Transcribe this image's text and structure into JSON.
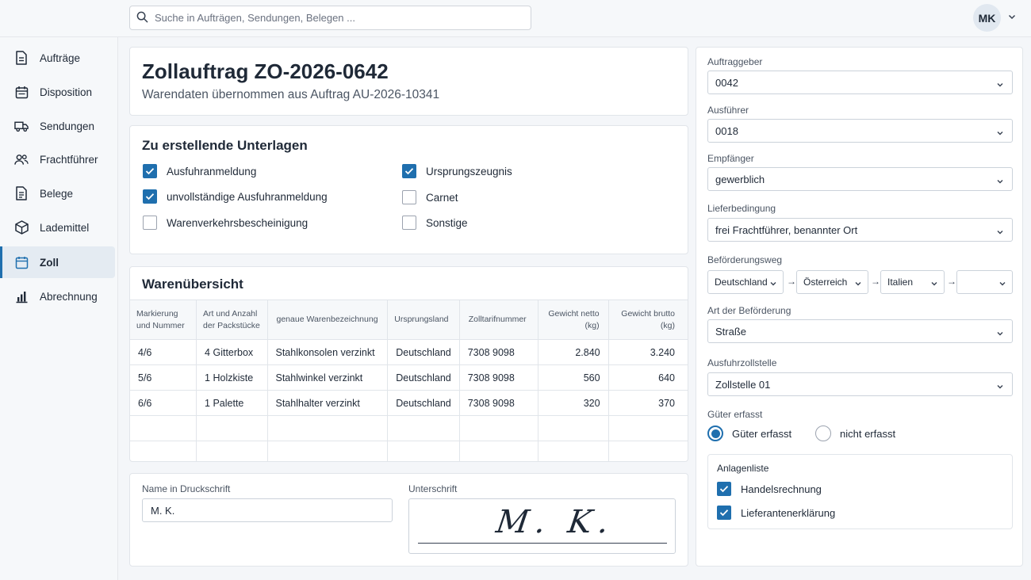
{
  "search": {
    "placeholder": "Suche in Aufträgen, Sendungen, Belegen ..."
  },
  "user": {
    "initials": "MK"
  },
  "sidebar": {
    "items": [
      {
        "label": "Aufträge",
        "icon": "document-icon"
      },
      {
        "label": "Disposition",
        "icon": "calendar-icon"
      },
      {
        "label": "Sendungen",
        "icon": "truck-icon"
      },
      {
        "label": "Frachtführer",
        "icon": "users-icon"
      },
      {
        "label": "Belege",
        "icon": "receipt-icon"
      },
      {
        "label": "Lademittel",
        "icon": "package-icon"
      },
      {
        "label": "Zoll",
        "icon": "customs-icon",
        "active": true
      },
      {
        "label": "Abrechnung",
        "icon": "bar-chart-icon"
      }
    ]
  },
  "order": {
    "title": "Zollauftrag ZO-2026-0642",
    "subtitle": "Warendaten übernommen aus Auftrag AU-2026-10341"
  },
  "documents": {
    "heading": "Zu erstellende Unterlagen",
    "left": [
      {
        "label": "Ausfuhranmeldung",
        "checked": true
      },
      {
        "label": "unvollständige Ausfuhranmeldung",
        "checked": true
      },
      {
        "label": "Warenverkehrsbescheinigung",
        "checked": false
      }
    ],
    "right": [
      {
        "label": "Ursprungszeugnis",
        "checked": true
      },
      {
        "label": "Carnet",
        "checked": false
      },
      {
        "label": "Sonstige",
        "checked": false
      }
    ]
  },
  "goods": {
    "heading": "Warenübersicht",
    "columns": [
      [
        "Markierung",
        "und Nummer"
      ],
      [
        "Art und Anzahl",
        "der Packstücke"
      ],
      [
        "genaue Warenbezeichnung"
      ],
      [
        "Ursprungsland"
      ],
      [
        "Zolltarifnummer"
      ],
      [
        "Gewicht netto",
        "(kg)"
      ],
      [
        "Gewicht brutto",
        "(kg)"
      ]
    ],
    "rows": [
      [
        "4/6",
        "4 Gitterbox",
        "Stahlkonsolen verzinkt",
        "Deutschland",
        "7308 9098",
        "2.840",
        "3.240"
      ],
      [
        "5/6",
        "1 Holzkiste",
        "Stahlwinkel verzinkt",
        "Deutschland",
        "7308 9098",
        "560",
        "640"
      ],
      [
        "6/6",
        "1 Palette",
        "Stahlhalter verzinkt",
        "Deutschland",
        "7308 9098",
        "320",
        "370"
      ],
      [
        "",
        "",
        "",
        "",
        "",
        "",
        ""
      ],
      [
        "",
        "",
        "",
        "",
        "",
        "",
        ""
      ]
    ]
  },
  "signature": {
    "name_label": "Name in Druckschrift",
    "name_value": "M. K.",
    "sign_label": "Unterschrift",
    "sign_text": "M. K."
  },
  "right_panel": {
    "auftraggeber": {
      "label": "Auftraggeber",
      "value": "0042"
    },
    "ausfuehrer": {
      "label": "Ausführer",
      "value": "0018"
    },
    "empfaenger": {
      "label": "Empfänger",
      "value": "gewerblich"
    },
    "lieferbedingung": {
      "label": "Lieferbedingung",
      "value": "frei Frachtführer, benannter Ort"
    },
    "befoerderungsweg": {
      "label": "Beförderungsweg",
      "stops": [
        "Deutschland",
        "Österreich",
        "Italien",
        ""
      ]
    },
    "art": {
      "label": "Art der Beförderung",
      "value": "Straße"
    },
    "zollstelle": {
      "label": "Ausfuhrzollstelle",
      "value": "Zollstelle 01"
    },
    "gueter": {
      "label": "Güter erfasst",
      "options": [
        {
          "label": "Güter erfasst",
          "selected": true
        },
        {
          "label": "nicht erfasst",
          "selected": false
        }
      ]
    },
    "anlagen": {
      "heading": "Anlagenliste",
      "items": [
        {
          "label": "Handelsrechnung",
          "checked": true
        },
        {
          "label": "Lieferantenerklärung",
          "checked": true
        }
      ]
    }
  },
  "colors": {
    "accent": "#1f6fae",
    "active_nav_bg": "#e4ebf2"
  }
}
